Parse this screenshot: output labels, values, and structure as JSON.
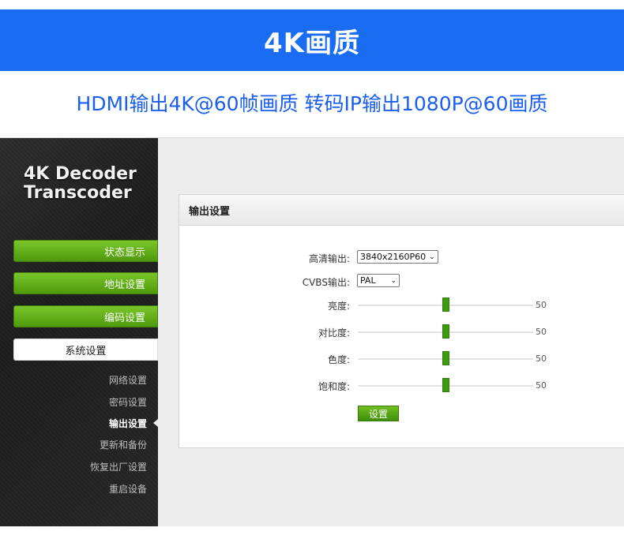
{
  "banner": {
    "title": "4K画质"
  },
  "subtitle": "HDMI输出4K@60帧画质   转码IP输出1080P@60画质",
  "app": {
    "logo_line1": "4K Decoder",
    "logo_line2": "Transcoder"
  },
  "nav": {
    "main": [
      {
        "label": "状态显示",
        "active": false
      },
      {
        "label": "地址设置",
        "active": false
      },
      {
        "label": "编码设置",
        "active": false
      },
      {
        "label": "系统设置",
        "active": true
      }
    ],
    "sub": [
      {
        "label": "网络设置",
        "current": false
      },
      {
        "label": "密码设置",
        "current": false
      },
      {
        "label": "输出设置",
        "current": true
      },
      {
        "label": "更新和备份",
        "current": false
      },
      {
        "label": "恢复出厂设置",
        "current": false
      },
      {
        "label": "重启设备",
        "current": false
      }
    ]
  },
  "panel": {
    "title": "输出设置",
    "hd_output": {
      "label": "高清输出:",
      "value": "3840x2160P60"
    },
    "cvbs_output": {
      "label": "CVBS输出:",
      "value": "PAL"
    },
    "sliders": [
      {
        "label": "亮度:",
        "value": 50,
        "min": 0,
        "max": 100
      },
      {
        "label": "对比度:",
        "value": 50,
        "min": 0,
        "max": 100
      },
      {
        "label": "色度:",
        "value": 50,
        "min": 0,
        "max": 100
      },
      {
        "label": "饱和度:",
        "value": 50,
        "min": 0,
        "max": 100
      }
    ],
    "submit_label": "设置"
  },
  "colors": {
    "banner": "#1a6df2",
    "subtitle": "#1a5ff0",
    "nav_green": "#5aa814",
    "slider_handle": "#3c9a0c"
  }
}
